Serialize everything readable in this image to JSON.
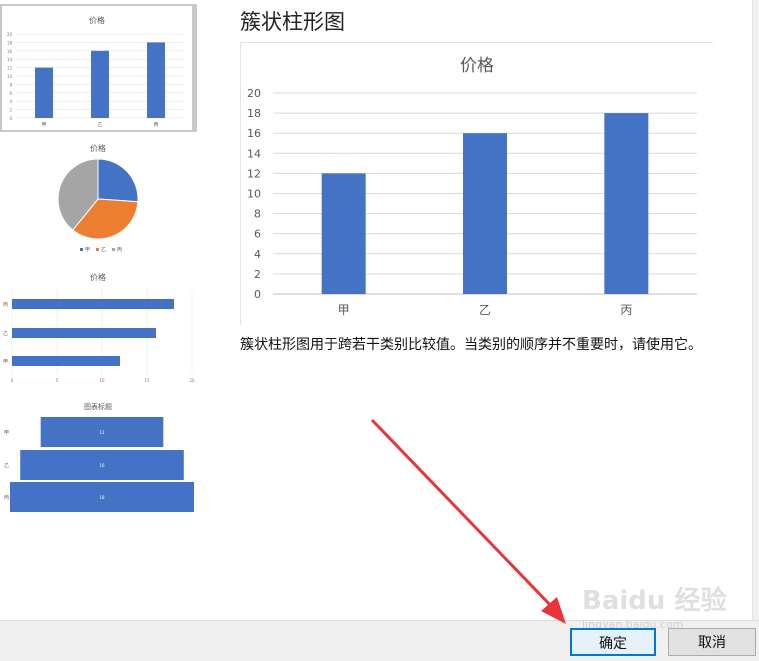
{
  "dialog": {
    "chart_type_title": "簇状柱形图",
    "description": "簇状柱形图用于跨若干类别比较值。当类别的顺序并不重要时，请使用它。",
    "ok_label": "确定",
    "cancel_label": "取消"
  },
  "thumbnails": {
    "column_title": "价格",
    "pie_title": "价格",
    "pie_legend": [
      "甲",
      "乙",
      "丙"
    ],
    "bar_title": "价格",
    "funnel_title": "图表标题",
    "funnel_labels": [
      "12",
      "16",
      "18"
    ]
  },
  "watermark": {
    "text": "Baidu 经验",
    "sub": "jingyan.baidu.com"
  },
  "colors": {
    "series_blue": "#4472c4",
    "pie_orange": "#ed7d31",
    "pie_gray": "#a5a5a5",
    "arrow_red": "#e8353a",
    "ok_border": "#0078d7"
  },
  "chart_data": [
    {
      "type": "bar",
      "title": "价格",
      "categories": [
        "甲",
        "乙",
        "丙"
      ],
      "values": [
        12,
        16,
        18
      ],
      "ylim": [
        0,
        20
      ],
      "yticks": [
        0,
        2,
        4,
        6,
        8,
        10,
        12,
        14,
        16,
        18,
        20
      ],
      "grid": true
    },
    {
      "type": "pie",
      "title": "价格",
      "categories": [
        "甲",
        "乙",
        "丙"
      ],
      "values": [
        12,
        16,
        18
      ],
      "legend": "bottom"
    },
    {
      "type": "bar",
      "orientation": "horizontal",
      "title": "价格",
      "categories": [
        "甲",
        "乙",
        "丙"
      ],
      "values": [
        12,
        16,
        18
      ],
      "xticks": [
        0,
        5,
        10,
        15,
        20
      ]
    },
    {
      "type": "bar",
      "orientation": "funnel",
      "title": "图表标题",
      "categories": [
        "甲",
        "乙",
        "丙"
      ],
      "values": [
        12,
        16,
        18
      ]
    }
  ]
}
